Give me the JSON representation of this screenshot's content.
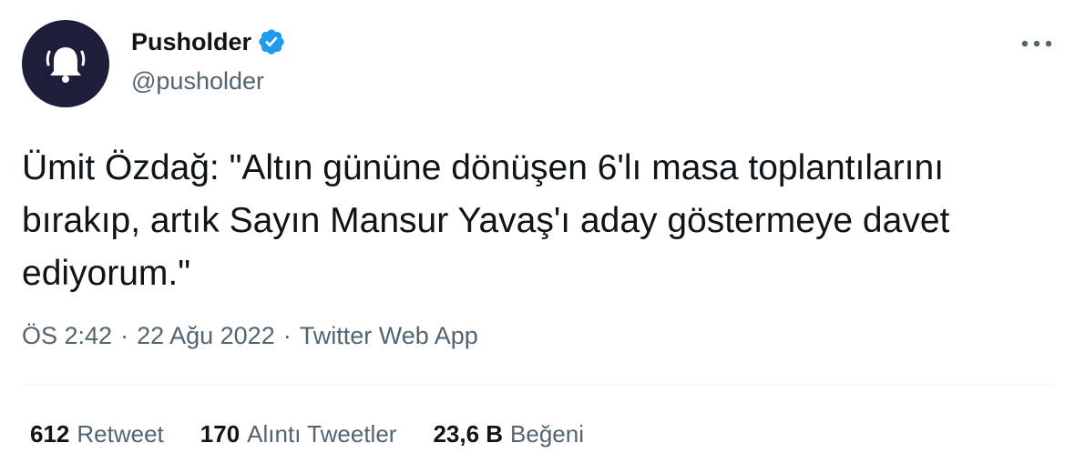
{
  "user": {
    "display_name": "Pusholder",
    "handle": "@pusholder",
    "verified": true,
    "avatar_icon": "bell-icon",
    "avatar_bg": "#1c1e3a",
    "verified_color": "#1d9bf0"
  },
  "tweet": {
    "text": "Ümit Özdağ: \"Altın gününe dönüşen 6'lı masa toplantılarını bırakıp, artık Sayın Mansur Yavaş'ı aday göstermeye davet ediyorum.\"",
    "time": "ÖS 2:42",
    "date": "22 Ağu 2022",
    "source": "Twitter Web App",
    "separator": "·"
  },
  "stats": {
    "retweets": {
      "count": "612",
      "label": "Retweet"
    },
    "quotes": {
      "count": "170",
      "label": "Alıntı Tweetler"
    },
    "likes": {
      "count": "23,6 B",
      "label": "Beğeni"
    }
  },
  "icons": {
    "more": "more-dots-icon",
    "verified": "verified-badge-icon"
  }
}
